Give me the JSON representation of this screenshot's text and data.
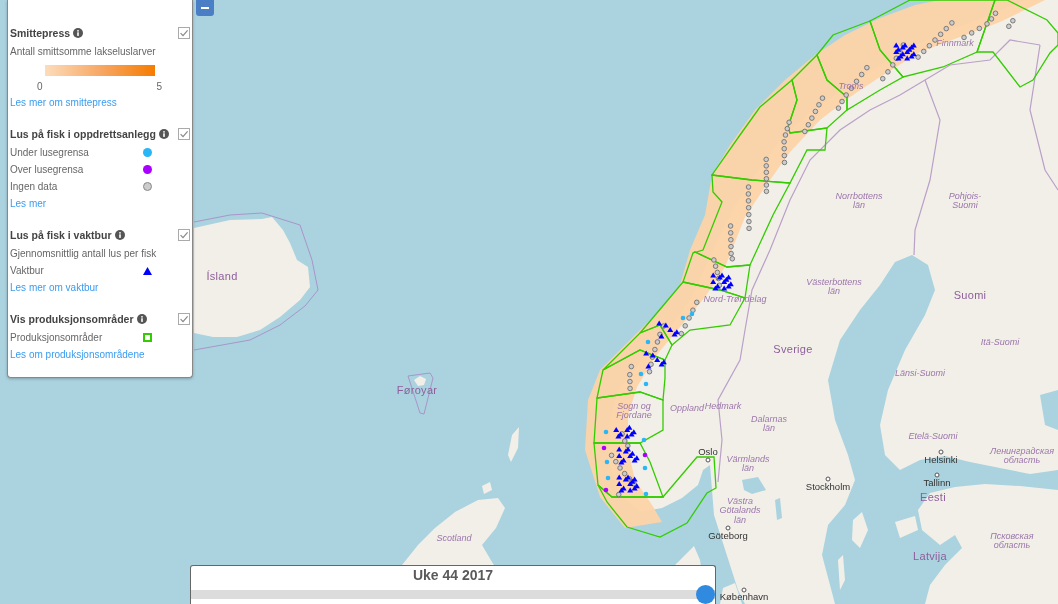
{
  "legend": {
    "sections": [
      {
        "heading": "Smittepress",
        "checked": true,
        "subtitle": "Antall smittsomme lakseluslarver",
        "scale": {
          "min": "0",
          "max": "5"
        },
        "link": "Les mer om smittepress"
      },
      {
        "heading": "Lus på fisk i oppdrettsanlegg",
        "checked": true,
        "items": [
          {
            "label": "Under lusegrensa",
            "kind": "dot",
            "color": "#29b6f6"
          },
          {
            "label": "Over lusegrensa",
            "kind": "dot",
            "color": "#aa00ff"
          },
          {
            "label": "Ingen data",
            "kind": "ring",
            "color": "#cccccc"
          }
        ],
        "link": "Les mer"
      },
      {
        "heading": "Lus på fisk i vaktbur",
        "checked": true,
        "subtitle": "Gjennomsnittlig antall lus per fisk",
        "items": [
          {
            "label": "Vaktbur",
            "kind": "triangle",
            "color": "#0000ff"
          }
        ],
        "link": "Les mer om vaktbur"
      },
      {
        "heading": "Vis produksjonsområder",
        "checked": true,
        "items": [
          {
            "label": "Produksjonsområder",
            "kind": "square",
            "color": "#33cc00"
          }
        ],
        "link": "Les om produksjonsområdene"
      }
    ]
  },
  "map": {
    "labels": [
      {
        "text": "Finnmark",
        "kind": "region"
      },
      {
        "text": "Troms",
        "kind": "region"
      },
      {
        "text": "Norrbottens län",
        "kind": "region"
      },
      {
        "text": "Pohjois-Suomi",
        "kind": "region"
      },
      {
        "text": "Ísland",
        "kind": "country"
      },
      {
        "text": "Nord-Trøndelag",
        "kind": "region"
      },
      {
        "text": "Västerbottens län",
        "kind": "region"
      },
      {
        "text": "Suomi",
        "kind": "country"
      },
      {
        "text": "Sverige",
        "kind": "country"
      },
      {
        "text": "Itä-Suomi",
        "kind": "region"
      },
      {
        "text": "Länsi-Suomi",
        "kind": "region"
      },
      {
        "text": "Føroyar",
        "kind": "country"
      },
      {
        "text": "Sogn og Fjordane",
        "kind": "region"
      },
      {
        "text": "Oppland",
        "kind": "region"
      },
      {
        "text": "Hedmark",
        "kind": "region"
      },
      {
        "text": "Dalarnas län",
        "kind": "region"
      },
      {
        "text": "Etelä-Suomi",
        "kind": "region"
      },
      {
        "text": "Oslo",
        "kind": "city"
      },
      {
        "text": "Värmlands län",
        "kind": "region"
      },
      {
        "text": "Helsinki",
        "kind": "city"
      },
      {
        "text": "Ленинградская область",
        "kind": "region"
      },
      {
        "text": "Stockholm",
        "kind": "city"
      },
      {
        "text": "Tallinn",
        "kind": "city"
      },
      {
        "text": "Västra Götalands län",
        "kind": "region"
      },
      {
        "text": "Eesti",
        "kind": "country"
      },
      {
        "text": "Scotland",
        "kind": "region"
      },
      {
        "text": "Göteborg",
        "kind": "city"
      },
      {
        "text": "Псковская область",
        "kind": "region"
      },
      {
        "text": "Latvija",
        "kind": "country"
      },
      {
        "text": "København",
        "kind": "city"
      }
    ]
  },
  "slider": {
    "title": "Uke 44 2017",
    "level": 1
  }
}
